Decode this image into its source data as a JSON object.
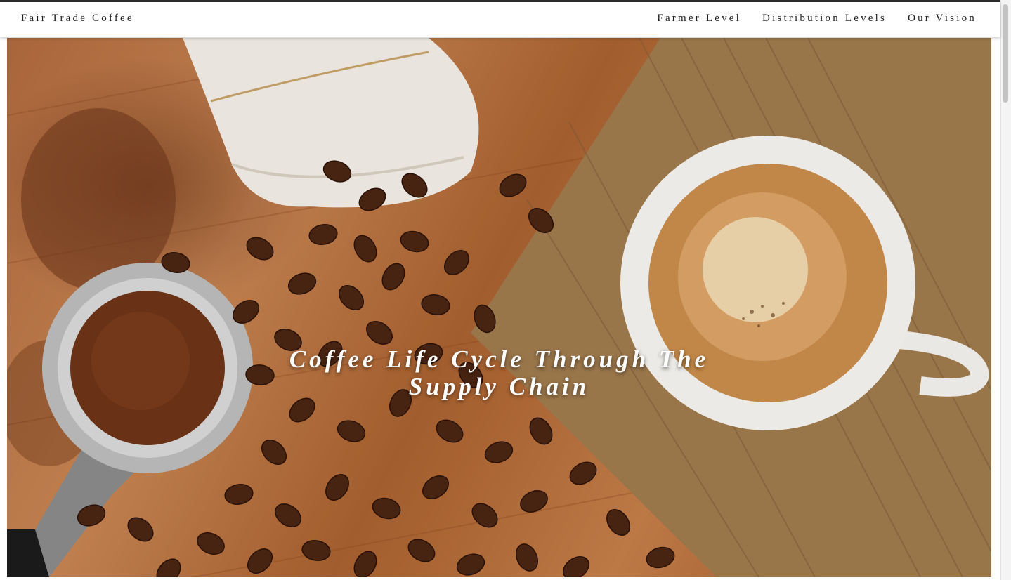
{
  "navbar": {
    "brand": "Fair Trade Coffee",
    "links": [
      {
        "label": "Farmer Level"
      },
      {
        "label": "Distribution Levels"
      },
      {
        "label": "Our Vision"
      }
    ]
  },
  "hero": {
    "title_line1": "Coffee Life Cycle Through The",
    "title_line2": "Supply Chain"
  },
  "colors": {
    "navbar_bg": "#ffffff",
    "nav_text": "#1e1e1e",
    "hero_title": "#ffffff",
    "wood": "#b06a3d",
    "coffee_bean": "#4a2512"
  },
  "icons": {
    "scroll": "vertical-scrollbar"
  }
}
